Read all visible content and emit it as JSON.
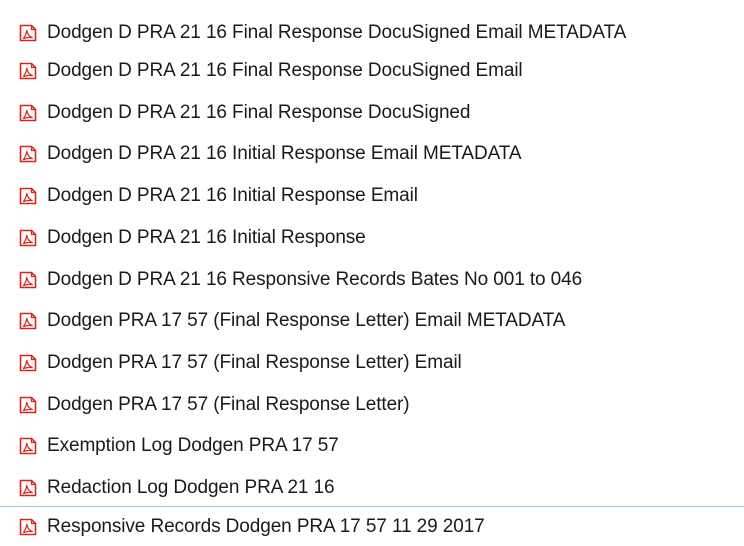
{
  "files": [
    {
      "name": "Dodgen D PRA 21 16 Final Response DocuSigned Email METADATA",
      "icon": "pdf-file-icon"
    },
    {
      "name": "Dodgen D PRA 21 16 Final Response DocuSigned Email",
      "icon": "pdf-file-icon"
    },
    {
      "name": "Dodgen D PRA 21 16 Final Response DocuSigned",
      "icon": "pdf-file-icon"
    },
    {
      "name": "Dodgen D PRA 21 16 Initial Response Email METADATA",
      "icon": "pdf-file-icon"
    },
    {
      "name": "Dodgen D PRA 21 16 Initial Response Email",
      "icon": "pdf-file-icon"
    },
    {
      "name": "Dodgen D PRA 21 16 Initial Response",
      "icon": "pdf-file-icon"
    },
    {
      "name": "Dodgen D PRA 21 16 Responsive Records Bates No 001 to 046",
      "icon": "pdf-file-icon"
    },
    {
      "name": "Dodgen PRA 17 57 (Final Response Letter) Email METADATA",
      "icon": "pdf-file-icon"
    },
    {
      "name": "Dodgen PRA 17 57 (Final Response Letter) Email",
      "icon": "pdf-file-icon"
    },
    {
      "name": "Dodgen PRA 17 57 (Final Response Letter)",
      "icon": "pdf-file-icon"
    },
    {
      "name": "Exemption Log Dodgen PRA 17 57",
      "icon": "pdf-file-icon"
    },
    {
      "name": "Redaction Log Dodgen PRA 21 16",
      "icon": "pdf-file-icon"
    },
    {
      "name": "Responsive Records Dodgen PRA 17 57 11 29 2017",
      "icon": "pdf-file-icon"
    }
  ],
  "colors": {
    "icon_red": "#d9261c",
    "focus_border": "#99c9ef",
    "text": "#1a1a1a"
  }
}
